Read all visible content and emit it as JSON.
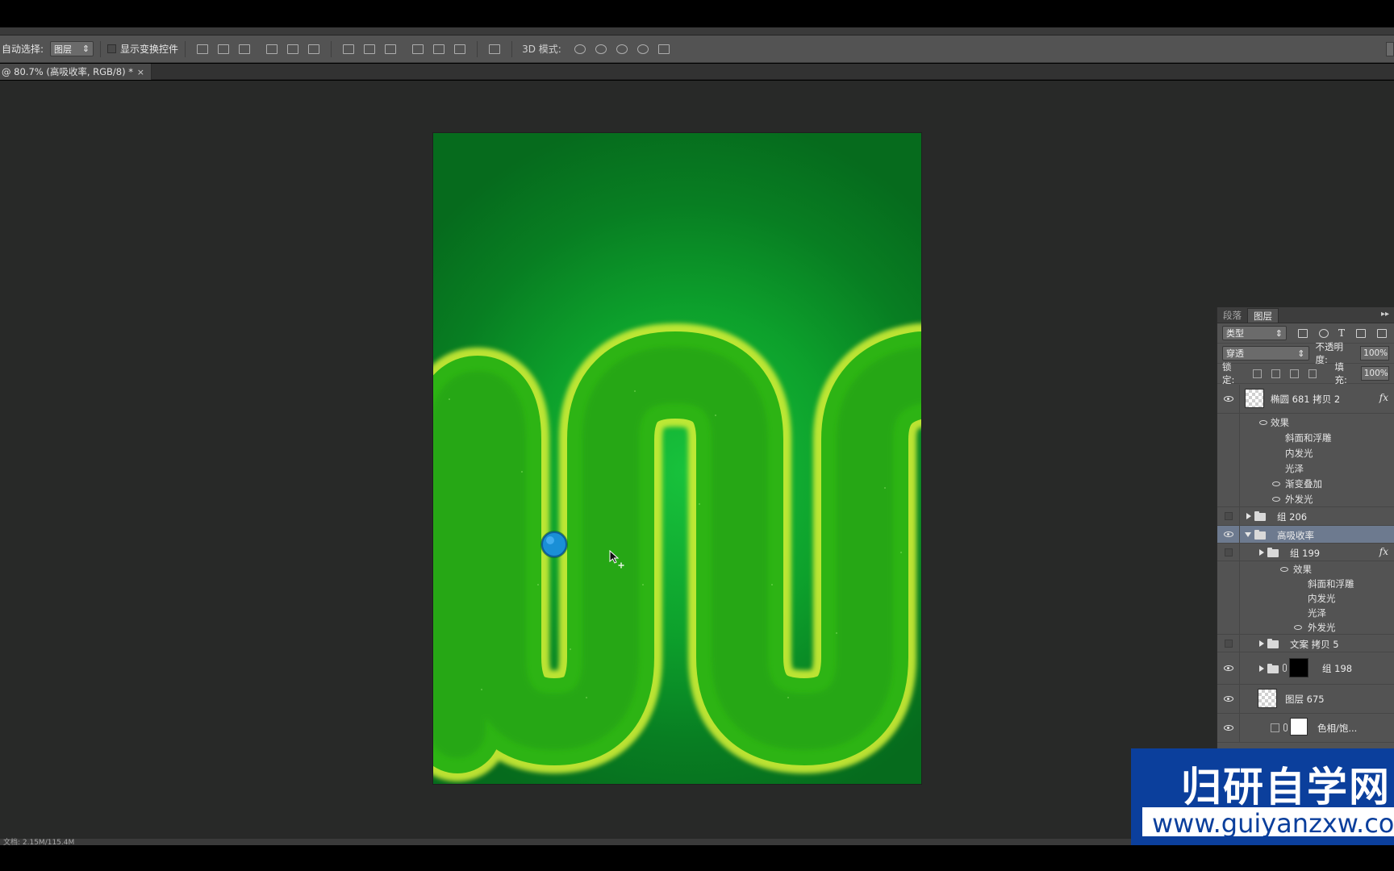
{
  "options_bar": {
    "auto_select_label": "自动选择:",
    "auto_select_value": "图层",
    "show_transform_label": "显示变换控件",
    "mode_3d_label": "3D 模式:"
  },
  "document_tab": {
    "title": "@ 80.7% (高吸收率, RGB/8) *",
    "close": "×"
  },
  "layers_panel": {
    "tabs": [
      "段落",
      "图层"
    ],
    "filter_select": "类型",
    "blend_mode": "穿透",
    "opacity_label": "不透明度:",
    "opacity_value": "100%",
    "lock_label": "锁定:",
    "fill_label": "填充:",
    "fill_value": "100%",
    "fx_label": "fx",
    "layers": [
      {
        "name": "椭圆 681 拷贝 2"
      },
      {
        "name": "效果"
      },
      {
        "name": "斜面和浮雕"
      },
      {
        "name": "内发光"
      },
      {
        "name": "光泽"
      },
      {
        "name": "渐变叠加"
      },
      {
        "name": "外发光"
      },
      {
        "name": "组 206"
      },
      {
        "name": "高吸收率"
      },
      {
        "name": "组 199"
      },
      {
        "name": "效果"
      },
      {
        "name": "斜面和浮雕"
      },
      {
        "name": "内发光"
      },
      {
        "name": "光泽"
      },
      {
        "name": "外发光"
      },
      {
        "name": "文案 拷贝 5"
      },
      {
        "name": "组 198"
      },
      {
        "name": "图层 675"
      },
      {
        "name": "色相/饱..."
      }
    ]
  },
  "status_bar": {
    "text": "文档: 2.15M/115.4M"
  },
  "watermark": {
    "title": "归研自学网",
    "url": "www.guiyanzxw.com"
  },
  "colors": {
    "canvas_green": "#0da12c",
    "track_green": "#2db414",
    "track_glow": "#d8f23a",
    "ball_blue": "#1a8fd6",
    "panel_bg": "#535353",
    "workspace_bg": "#282928",
    "watermark_blue": "#0b3f9c"
  }
}
